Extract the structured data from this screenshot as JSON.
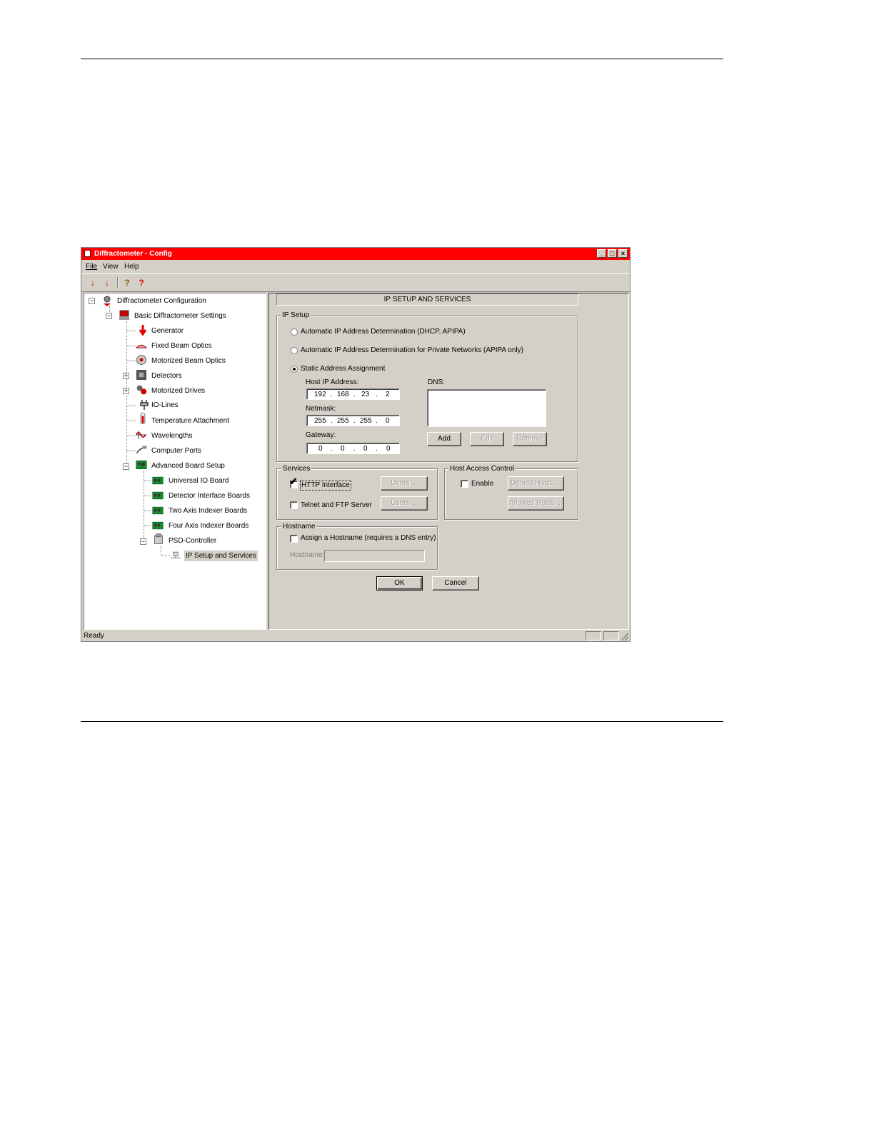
{
  "window": {
    "title": "Diffractometer - Config",
    "controls": {
      "minimize": "_",
      "maximize": "□",
      "close": "×"
    }
  },
  "menu": {
    "file": "File",
    "view": "View",
    "help": "Help"
  },
  "toolbar": {
    "icons": [
      "cnf-arrow-icon",
      "psd-arrow-icon",
      "help-icon",
      "context-help-icon"
    ],
    "labels": {
      "b1": "↓",
      "b2": "↓",
      "b3": "?",
      "b4": "?"
    }
  },
  "tree": {
    "root": "Diffractometer Configuration",
    "basic": "Basic Diffractometer Settings",
    "generator": "Generator",
    "fixed_beam": "Fixed Beam Optics",
    "motorized_beam": "Motorized Beam Optics",
    "detectors": "Detectors",
    "motorized_drives": "Motorized Drives",
    "io_lines": "IO-Lines",
    "temperature": "Temperature Attachment",
    "wavelengths": "Wavelengths",
    "computer_ports": "Computer Ports",
    "advanced": "Advanced Board Setup",
    "universal_io": "Universal IO Board",
    "detector_interface": "Detector Interface Boards",
    "two_axis": "Two Axis Indexer Boards",
    "four_axis": "Four Axis Indexer Boards",
    "psd": "PSD-Controller",
    "ip_setup": "IP Setup and Services"
  },
  "panel": {
    "header": "IP SETUP AND SERVICES",
    "ip_setup": {
      "group_label": "IP Setup",
      "radio_dhcp": "Automatic IP Address Determination (DHCP, APIPA)",
      "radio_apipa": "Automatic IP Address Determination for Private Networks (APIPA only)",
      "radio_static": "Static Address Assignment",
      "host_ip_label": "Host IP Address:",
      "host_ip": [
        "192",
        "168",
        "23",
        "2"
      ],
      "netmask_label": "Netmask:",
      "netmask": [
        "255",
        "255",
        "255",
        "0"
      ],
      "gateway_label": "Gateway:",
      "gateway": [
        "0",
        "0",
        "0",
        "0"
      ],
      "dot": ".",
      "dns_label": "DNS:",
      "add": "Add",
      "edit": "Edit",
      "remove": "Remove"
    },
    "services": {
      "group_label": "Services",
      "http": "HTTP Interface",
      "telnet": "Telnet and FTP Server",
      "users1": "Users ...",
      "users2": "Users ..."
    },
    "host_access": {
      "group_label": "Host Access Control",
      "enable": "Enable",
      "denied": "Denied Hosts ...",
      "allowed": "Allowed Hosts ..."
    },
    "hostname": {
      "group_label": "Hostname",
      "assign": "Assign a Hostname (requires a DNS entry)",
      "field_label": "Hostname:"
    },
    "ok": "OK",
    "cancel": "Cancel"
  },
  "status": {
    "text": "Ready"
  }
}
